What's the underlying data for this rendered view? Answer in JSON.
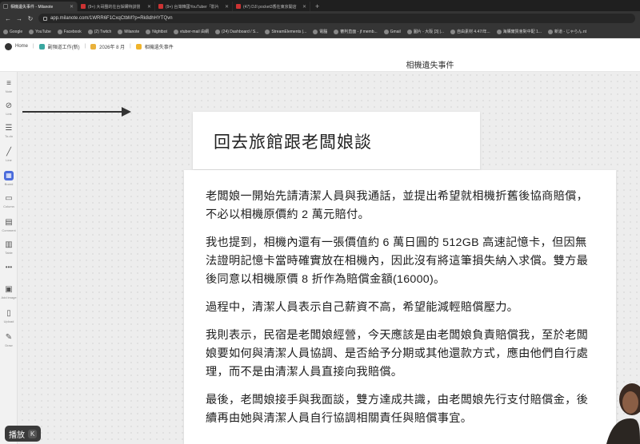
{
  "browser": {
    "tabs": [
      {
        "title": "相機遺失事件 - Milanote",
        "active": true
      },
      {
        "title": "(9+) 大哥團的在台採購特訓營",
        "active": false
      },
      {
        "title": "(9+) 台灣韓國YouTuber「影片",
        "active": false
      },
      {
        "title": "(47) DJI pocket3香在東京開店",
        "active": false
      }
    ],
    "url": "app.milanote.com/1WRR6F1CxqCtbM?p=Rk8dhHYTQvn",
    "bookmarks": [
      "Google",
      "YouTube",
      "Facebook",
      "(2) Twitch",
      "Milanote",
      "Nightbot",
      "vtuber-mail 由網",
      "(24) Dashboard / S...",
      "StreamElements |...",
      "電腦",
      "審判直面 - jf memb...",
      "Gmail",
      "圖片 - 大阪 [3] |...",
      "自由素材 4.47/年...",
      "海購實質會對中配 1...",
      "新道 - じゃらん.nt"
    ]
  },
  "app": {
    "home": "Home",
    "crumb1": "副頻道工作(新)",
    "crumb2": "2026年 8 月",
    "crumb3": "相機遺失事件",
    "board_title": "相機遺失事件"
  },
  "toolbar": [
    "Note",
    "Link",
    "To-do",
    "Line",
    "Board",
    "Column",
    "Comment",
    "Table",
    "•••",
    "Add image",
    "Upload",
    "Draw"
  ],
  "heading": "回去旅館跟老闆娘談",
  "paragraphs": [
    "老闆娘一開始先請清潔人員與我通話，並提出希望就相機折舊後協商賠償，不必以相機原價約 2 萬元賠付。",
    "我也提到，相機內還有一張價值約 6 萬日圓的 512GB 高速記憶卡，但因無法證明記憶卡當時確實放在相機內，因此沒有將這筆損失納入求償。雙方最後同意以相機原價 8 折作為賠償金額(16000)。",
    "過程中，清潔人員表示自己薪資不高，希望能減輕賠償壓力。",
    "我則表示，民宿是老闆娘經營，今天應該是由老闆娘負責賠償我，至於老闆娘要如何與清潔人員協調、是否給予分期或其他還款方式，應由他們自行處理，而不是由清潔人員直接向我賠償。",
    "最後，老闆娘接手與我面談，雙方達成共識，由老闆娘先行支付賠償金，後續再由她與清潔人員自行協調相關責任與賠償事宜。"
  ],
  "player": {
    "label": "播放",
    "key": "K"
  }
}
